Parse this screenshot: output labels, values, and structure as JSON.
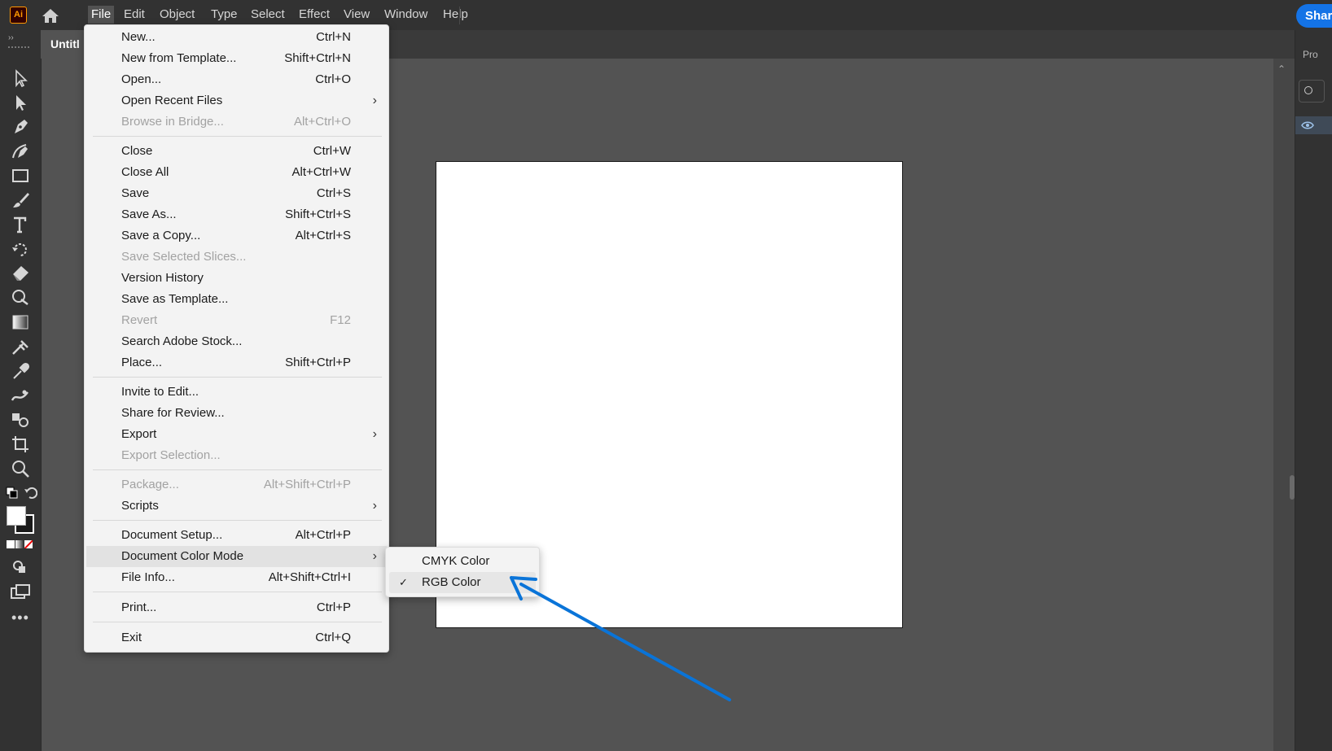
{
  "app": {
    "logo_text": "Ai",
    "menubar": [
      "File",
      "Edit",
      "Object",
      "Type",
      "Select",
      "Effect",
      "View",
      "Window",
      "Help"
    ],
    "active_menu": "File",
    "share_label": "Share",
    "document_tab": "Untitl",
    "right_panel_title": "Pro",
    "accent_color": "#1473e6",
    "annotation_arrow_color": "#0a74d8"
  },
  "file_menu": {
    "items": [
      {
        "label": "New...",
        "shortcut": "Ctrl+N"
      },
      {
        "label": "New from Template...",
        "shortcut": "Shift+Ctrl+N"
      },
      {
        "label": "Open...",
        "shortcut": "Ctrl+O"
      },
      {
        "label": "Open Recent Files",
        "shortcut": ""
      },
      {
        "label": "Browse in Bridge...",
        "shortcut": "Alt+Ctrl+O"
      },
      {
        "label": "Close",
        "shortcut": "Ctrl+W"
      },
      {
        "label": "Close All",
        "shortcut": "Alt+Ctrl+W"
      },
      {
        "label": "Save",
        "shortcut": "Ctrl+S"
      },
      {
        "label": "Save As...",
        "shortcut": "Shift+Ctrl+S"
      },
      {
        "label": "Save a Copy...",
        "shortcut": "Alt+Ctrl+S"
      },
      {
        "label": "Save Selected Slices...",
        "shortcut": ""
      },
      {
        "label": "Version History",
        "shortcut": ""
      },
      {
        "label": "Save as Template...",
        "shortcut": ""
      },
      {
        "label": "Revert",
        "shortcut": "F12"
      },
      {
        "label": "Search Adobe Stock...",
        "shortcut": ""
      },
      {
        "label": "Place...",
        "shortcut": "Shift+Ctrl+P"
      },
      {
        "label": "Invite to Edit...",
        "shortcut": ""
      },
      {
        "label": "Share for Review...",
        "shortcut": ""
      },
      {
        "label": "Export",
        "shortcut": ""
      },
      {
        "label": "Export Selection...",
        "shortcut": ""
      },
      {
        "label": "Package...",
        "shortcut": "Alt+Shift+Ctrl+P"
      },
      {
        "label": "Scripts",
        "shortcut": ""
      },
      {
        "label": "Document Setup...",
        "shortcut": "Alt+Ctrl+P"
      },
      {
        "label": "Document Color Mode",
        "shortcut": ""
      },
      {
        "label": "File Info...",
        "shortcut": "Alt+Shift+Ctrl+I"
      },
      {
        "label": "Print...",
        "shortcut": "Ctrl+P"
      },
      {
        "label": "Exit",
        "shortcut": "Ctrl+Q"
      }
    ]
  },
  "color_mode_submenu": {
    "items": [
      {
        "label": "CMYK Color",
        "checked": false
      },
      {
        "label": "RGB Color",
        "checked": true
      }
    ],
    "check_glyph": "✓"
  },
  "toolbar": {
    "tools": [
      "selection-tool-icon",
      "direct-selection-tool-icon",
      "pen-tool-icon",
      "curvature-tool-icon",
      "rectangle-tool-icon",
      "paintbrush-tool-icon",
      "type-tool-icon",
      "rotate-tool-icon",
      "eraser-tool-icon",
      "shape-builder-tool-icon",
      "gradient-tool-icon",
      "eyedropper-variant-icon",
      "eyedropper-tool-icon",
      "width-tool-icon",
      "symbol-sprayer-tool-icon",
      "artboard-tool-icon",
      "zoom-tool-icon"
    ]
  }
}
